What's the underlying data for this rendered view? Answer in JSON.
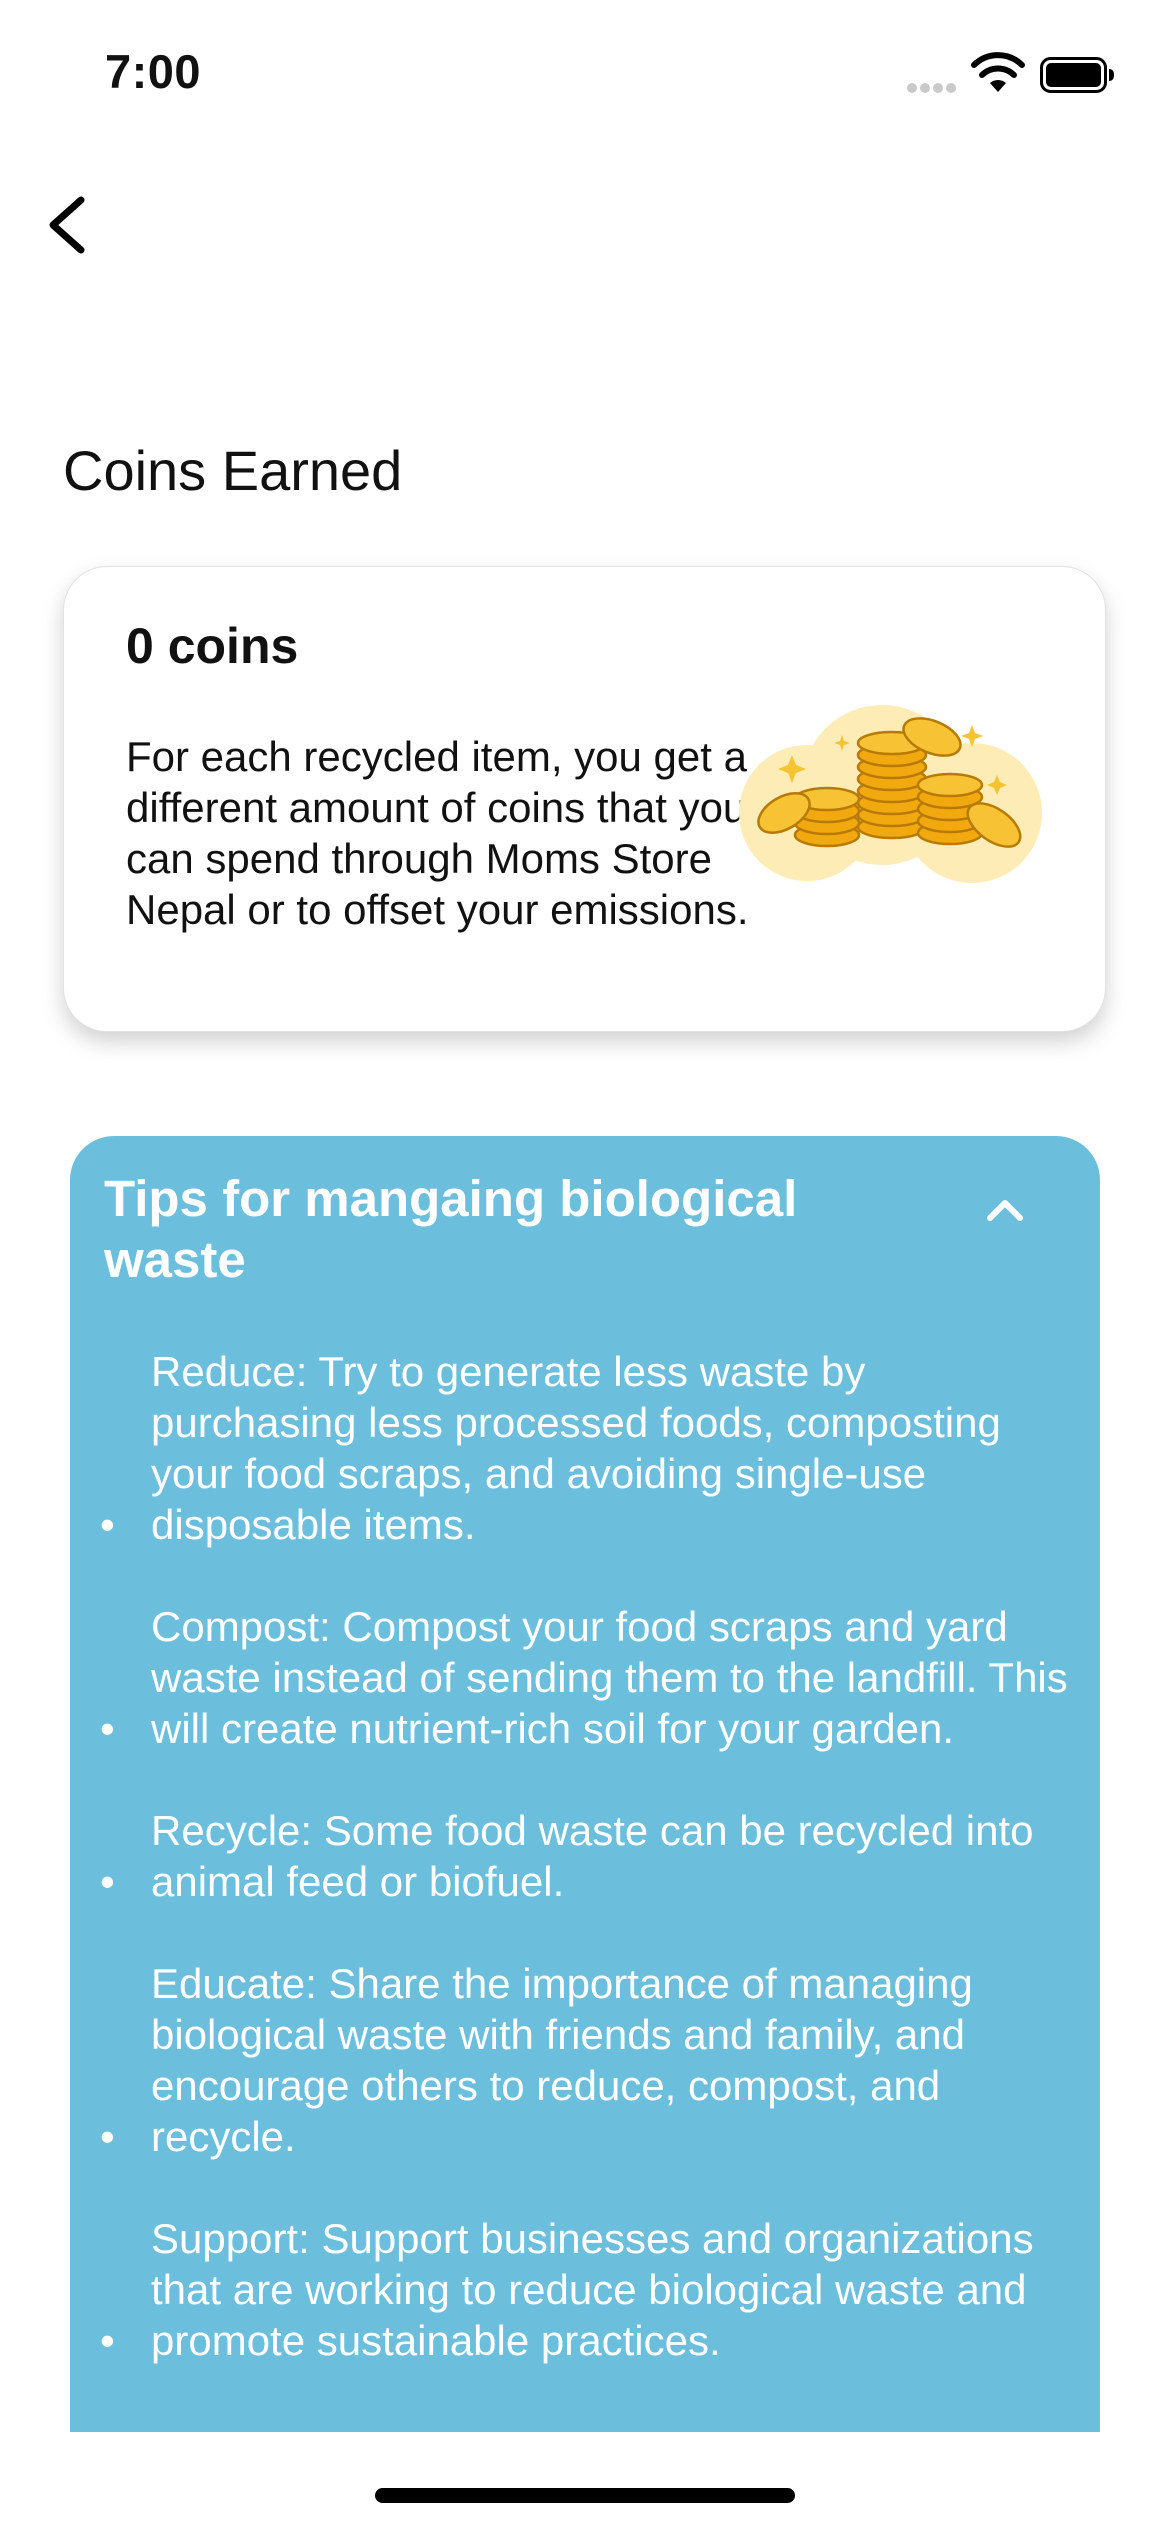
{
  "status_bar": {
    "time": "7:00"
  },
  "page": {
    "title": "Coins Earned"
  },
  "coins_card": {
    "amount": "0 coins",
    "description": "For each recycled item, you get a different amount of coins that you can spend through Moms Store Nepal or to offset your emissions.",
    "illustration_icon": "coin-stack-icon"
  },
  "tips": {
    "title": "Tips for mangaing biological waste",
    "collapse_icon": "chevron-up-icon",
    "items": [
      {
        "text": "Reduce: Try to generate less waste by purchasing less processed foods, composting your food scraps, and avoiding single-use disposable items."
      },
      {
        "text": "Compost: Compost your food scraps and yard waste instead of sending them to the landfill. This will create nutrient-rich soil for your garden."
      },
      {
        "text": "Recycle: Some food waste can be recycled into animal feed or biofuel."
      },
      {
        "text": "Educate: Share the importance of managing biological waste with friends and family, and encourage others to reduce, compost, and recycle."
      },
      {
        "text": "Support: Support businesses and organizations that are working to reduce biological waste and promote sustainable practices."
      }
    ]
  },
  "colors": {
    "tips_background": "#6bbfdd",
    "coin_gold": "#f5b316",
    "coin_glow": "#fde9a8"
  }
}
